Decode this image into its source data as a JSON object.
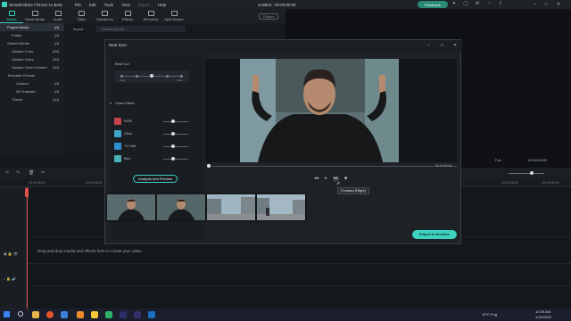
{
  "app": {
    "name": "Wondershare Filmora 11 Beta",
    "menu": [
      "File",
      "Edit",
      "Tools",
      "View",
      "Export",
      "Help"
    ],
    "document_title": "Untitled : 00:00:00:00",
    "feedback_label": "Feedback"
  },
  "toolbar": {
    "tabs": [
      "Media",
      "Stock Media",
      "Audio",
      "Titles",
      "Transitions",
      "Effects",
      "Elements",
      "Split Screen"
    ],
    "active_tab": "Media",
    "export_label": "Export"
  },
  "media_panel": {
    "items": [
      {
        "label": "Project Media",
        "count": "(0)",
        "level": 0,
        "selected": true
      },
      {
        "label": "Folder",
        "count": "(0)",
        "level": 1
      },
      {
        "label": "Shared Media",
        "count": "(0)",
        "level": 0
      },
      {
        "label": "Sample Color",
        "count": "(25)",
        "level": 1
      },
      {
        "label": "Sample Video",
        "count": "(20)",
        "level": 1
      },
      {
        "label": "Sample Green Screen",
        "count": "(10)",
        "level": 1
      },
      {
        "label": "Template Presets",
        "count": "",
        "level": 0
      },
      {
        "label": "Custom",
        "count": "(0)",
        "level": 2
      },
      {
        "label": "All Template",
        "count": "(0)",
        "level": 2
      },
      {
        "label": "Theme",
        "count": "(10)",
        "level": 1
      }
    ],
    "import_label": "Import",
    "record_label": "Record",
    "search_placeholder": "Search media"
  },
  "dialog": {
    "title": "Beat Sync",
    "beat_cut_label": "Beat Cut",
    "beat_fast": "Fast",
    "beat_slow": "Slow",
    "video_effect_label": "Video Effect",
    "effects": [
      {
        "name": "RGB",
        "color": "#c6454d"
      },
      {
        "name": "Glow",
        "color": "#3aa7c9"
      },
      {
        "name": "TV Hall",
        "color": "#2e8fcf"
      },
      {
        "name": "Blur",
        "color": "#4ab0b5"
      }
    ],
    "analysis_button": "Analysis and Preview",
    "timecode": "00:00:00:00",
    "tooltip": "Forward (Right)",
    "export_button": "Export to timeline"
  },
  "timeline": {
    "ruler_labels": [
      "00:00:00:00",
      "00:00:05:00",
      "00:00:25:00",
      "00:00:30:00"
    ],
    "drop_text": "Drag and drop media and effects here to create your video.",
    "quality": "Full",
    "preview_time": "00:00:00:00"
  },
  "taskbar": {
    "weather": "10°C  Fog",
    "time": "10:39 AM",
    "date": "1/15/2022"
  },
  "colors": {
    "accent": "#3fd1bf",
    "playhead": "#e0504a"
  }
}
